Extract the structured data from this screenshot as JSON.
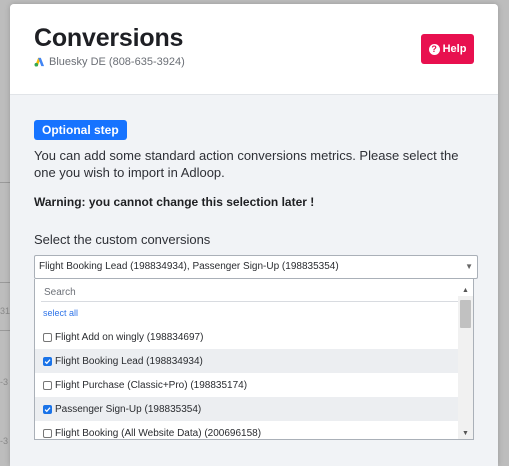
{
  "modal": {
    "title": "Conversions",
    "account": "Bluesky DE (808-635-3924)",
    "help_label": "Help",
    "badge": "Optional step",
    "intro": "You can add some standard action conversions metrics. Please select the one you wish to import in Adloop.",
    "warning": "Warning: you cannot change this selection later !",
    "select_label": "Select the custom conversions",
    "select_value": "Flight Booking Lead (198834934), Passenger Sign-Up (198835354)",
    "dropdown": {
      "search_placeholder": "Search",
      "select_all": "select all",
      "options": [
        {
          "label": "Flight Add on wingly (198834697)",
          "checked": false
        },
        {
          "label": "Flight Booking Lead (198834934)",
          "checked": true
        },
        {
          "label": "Flight Purchase (Classic+Pro) (198835174)",
          "checked": false
        },
        {
          "label": "Passenger Sign-Up (198835354)",
          "checked": true
        },
        {
          "label": "Flight Booking (All Website Data) (200696158)",
          "checked": false
        }
      ]
    }
  },
  "background_fragments": [
    "31",
    "-3",
    "-3"
  ],
  "colors": {
    "help_button": "#e8104f",
    "badge": "#1673ff",
    "checkbox_checked": "#1a73e8",
    "link": "#2f74e8"
  },
  "icons": [
    "google-ads-logo-icon",
    "help-circle-icon",
    "dropdown-caret-icon",
    "check-icon",
    "scroll-up-icon",
    "scroll-down-icon"
  ]
}
